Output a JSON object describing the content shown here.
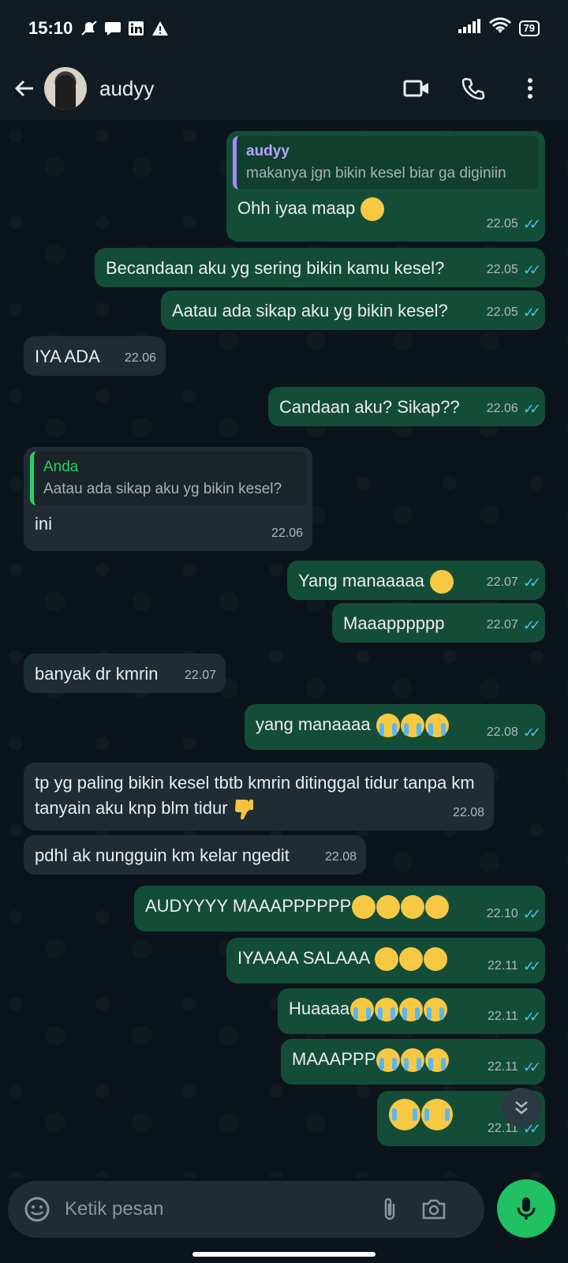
{
  "status_bar": {
    "time": "15:10",
    "battery": "79"
  },
  "header": {
    "contact_name": "audyy"
  },
  "messages": [
    {
      "dir": "out",
      "quote_name": "audyy",
      "quote_text": "makanya jgn bikin kesel biar ga diginiin",
      "text": "Ohh iyaa maap",
      "emoji": [
        "pensive"
      ],
      "time": "22.05"
    },
    {
      "dir": "out",
      "text": "Becandaan aku yg sering bikin kamu kesel?",
      "time": "22.05"
    },
    {
      "dir": "out",
      "text": "Aatau ada sikap aku yg bikin kesel?",
      "time": "22.05"
    },
    {
      "dir": "in",
      "text": "IYA ADA",
      "time": "22.06"
    },
    {
      "dir": "out",
      "text": "Candaan aku? Sikap??",
      "time": "22.06"
    },
    {
      "dir": "in",
      "quote_name": "Anda",
      "quote_text": "Aatau ada sikap aku yg bikin kesel?",
      "text": "ini",
      "time": "22.06"
    },
    {
      "dir": "out",
      "text": "Yang manaaaaa",
      "emoji": [
        "pleading"
      ],
      "time": "22.07"
    },
    {
      "dir": "out",
      "text": "Maaapppppp",
      "time": "22.07"
    },
    {
      "dir": "in",
      "text": "banyak dr kmrin",
      "time": "22.07"
    },
    {
      "dir": "out",
      "text": "yang manaaaa",
      "emoji": [
        "crying",
        "crying",
        "crying"
      ],
      "time": "22.08"
    },
    {
      "dir": "in",
      "text": "tp yg paling bikin kesel tbtb kmrin ditinggal tidur tanpa km tanyain aku knp blm tidur",
      "emoji": [
        "thumbs-down"
      ],
      "time": "22.08"
    },
    {
      "dir": "in",
      "text": "pdhl ak nungguin km kelar ngedit",
      "time": "22.08"
    },
    {
      "dir": "out",
      "text": "AUDYYYY MAAAPPPPPP",
      "emoji": [
        "pleading",
        "pleading",
        "pleading",
        "pleading"
      ],
      "time": "22.10"
    },
    {
      "dir": "out",
      "text": "IYAAAA SALAAA",
      "emoji": [
        "pensive",
        "pensive",
        "pensive"
      ],
      "time": "22.11"
    },
    {
      "dir": "out",
      "text": "Huaaaa",
      "emoji": [
        "crying",
        "crying",
        "crying",
        "crying"
      ],
      "time": "22.11"
    },
    {
      "dir": "out",
      "text": "MAAAPPP",
      "emoji": [
        "crying",
        "crying",
        "crying"
      ],
      "time": "22.11"
    },
    {
      "dir": "out",
      "text": "",
      "emoji": [
        "crying",
        "crying"
      ],
      "time": "22.11"
    }
  ],
  "composer": {
    "placeholder": "Ketik pesan"
  },
  "colors": {
    "outgoing": "#144d37",
    "incoming": "#202c33",
    "accent": "#21c063",
    "read_ticks": "#53bdeb"
  },
  "icons": [
    "back-arrow-icon",
    "video-call-icon",
    "voice-call-icon",
    "more-icon",
    "emoji-icon",
    "attach-icon",
    "camera-icon",
    "mic-icon",
    "scroll-down-icon"
  ]
}
